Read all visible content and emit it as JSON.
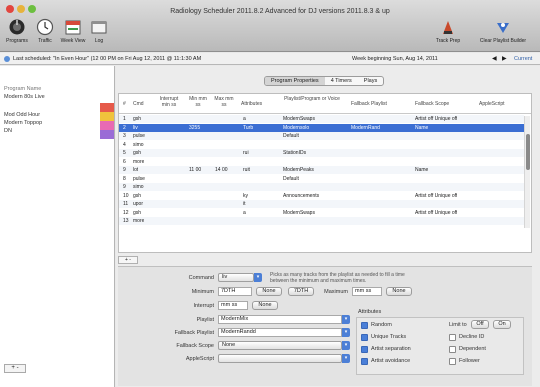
{
  "window": {
    "title": "Radiology Scheduler 2011.8.2 Advanced for DJ versions 2011.8.3 & up"
  },
  "toolbar": {
    "left": [
      {
        "label": "Programs",
        "icon": "radio-dial-icon"
      },
      {
        "label": "Traffic",
        "icon": "clock-icon"
      },
      {
        "label": "Week View",
        "icon": "calendar-icon"
      },
      {
        "label": "Log",
        "icon": "log-window-icon"
      }
    ],
    "right": [
      {
        "label": "Track Prep",
        "icon": "track-prep-icon"
      },
      {
        "label": "Clear Playlist Builder",
        "icon": "playlist-builder-icon"
      }
    ]
  },
  "status": {
    "last_scheduled": "Last scheduled: \"In Even Hour\" (12 00 PM on Fri Aug 12, 2011 @ 11:1:30 AM",
    "week_label": "Week beginning Sun, Aug 14, 2011",
    "prev": "◀",
    "next": "▶",
    "current": "Current"
  },
  "sidebar": {
    "items": [
      {
        "label": "Program Name"
      },
      {
        "label": "Modern 80s Live"
      },
      {
        "label": "Mod Odd Hour"
      },
      {
        "label": "Modern Toppop"
      },
      {
        "label": "DN"
      }
    ],
    "add_label": "+ -"
  },
  "program_tabs": [
    {
      "label": "Program Properties",
      "active": true
    },
    {
      "label": "4 Timers"
    },
    {
      "label": "Plays"
    }
  ],
  "table": {
    "columns": [
      "#",
      "Cmd",
      "Interrupt min ss",
      "Min mm ss",
      "Max mm ss",
      "Attributes",
      "Playlist/Program or Voice",
      "Fallback Playlist",
      "Fallback Scope",
      "AppleScript"
    ],
    "rows": [
      {
        "n": "1",
        "cmd": "gsh",
        "interrupt": "",
        "min": "",
        "max": "",
        "attr": "a",
        "playlist": "ModernSwaps",
        "fallback": "",
        "scope": "Artist off  Unique off",
        "script": ""
      },
      {
        "n": "2",
        "cmd": "liv",
        "interrupt": "",
        "min": "3255",
        "max": "",
        "attr": "Turb",
        "playlist": "Modernsolo",
        "fallback": "ModernRand",
        "scope": "Name",
        "script": ""
      },
      {
        "n": "3",
        "cmd": "pulse",
        "interrupt": "",
        "min": "",
        "max": "",
        "attr": "",
        "playlist": "Default",
        "fallback": "",
        "scope": "",
        "script": ""
      },
      {
        "n": "4",
        "cmd": "simo",
        "interrupt": "",
        "min": "",
        "max": "",
        "attr": "",
        "playlist": "",
        "fallback": "",
        "scope": "",
        "script": ""
      },
      {
        "n": "5",
        "cmd": "gsh",
        "interrupt": "",
        "min": "",
        "max": "",
        "attr": "rui",
        "playlist": "StationIDs",
        "fallback": "",
        "scope": "",
        "script": ""
      },
      {
        "n": "6",
        "cmd": "more",
        "interrupt": "",
        "min": "",
        "max": "",
        "attr": "",
        "playlist": "",
        "fallback": "",
        "scope": "",
        "script": ""
      },
      {
        "n": "9",
        "cmd": "lot",
        "interrupt": "",
        "min": "11 00",
        "max": "14 00",
        "attr": "ruit",
        "playlist": "ModernPeaks",
        "fallback": "",
        "scope": "Name",
        "script": ""
      },
      {
        "n": "8",
        "cmd": "pulse",
        "interrupt": "",
        "min": "",
        "max": "",
        "attr": "",
        "playlist": "Default",
        "fallback": "",
        "scope": "",
        "script": ""
      },
      {
        "n": "9",
        "cmd": "simo",
        "interrupt": "",
        "min": "",
        "max": "",
        "attr": "",
        "playlist": "",
        "fallback": "",
        "scope": "",
        "script": ""
      },
      {
        "n": "10",
        "cmd": "gsh",
        "interrupt": "",
        "min": "",
        "max": "",
        "attr": "ky",
        "playlist": "Announcements",
        "fallback": "",
        "scope": "Artist off  Unique off",
        "script": ""
      },
      {
        "n": "11",
        "cmd": "upor",
        "interrupt": "",
        "min": "",
        "max": "",
        "attr": "it",
        "playlist": "",
        "fallback": "",
        "scope": "",
        "script": ""
      },
      {
        "n": "12",
        "cmd": "gsh",
        "interrupt": "",
        "min": "",
        "max": "",
        "attr": "a",
        "playlist": "ModernSwaps",
        "fallback": "",
        "scope": "Artist off  Unique off",
        "script": ""
      },
      {
        "n": "13",
        "cmd": "more",
        "interrupt": "",
        "min": "",
        "max": "",
        "attr": "",
        "playlist": "",
        "fallback": "",
        "scope": "",
        "script": ""
      }
    ],
    "add_label": "+ -"
  },
  "editor": {
    "command_label": "Command",
    "command_value": "liv",
    "command_note": "Picks as many tracks from the playlist as needed to fill a time between the minimum and maximum times.",
    "minimum_label": "Minimum",
    "minimum_value": "7DTH",
    "minimum_btn": "None",
    "maximum_btn_left": "7DTH",
    "maximum_label": "Maximum",
    "maximum_value": "mm ss",
    "maximum_btn": "None",
    "interrupt_label": "Interrupt",
    "interrupt_value": "mm ss",
    "interrupt_btn": "None",
    "playlist_label": "Playlist",
    "playlist_value": "ModernMix",
    "fallback_playlist_label": "Fallback Playlist",
    "fallback_playlist_value": "ModernRandd",
    "fallback_scope_label": "Fallback Scope",
    "fallback_scope_value": "None",
    "applescript_label": "AppleScript",
    "applescript_value": "",
    "attributes_label": "Attributes",
    "limit_label": "Limit to",
    "limit_value": "Off",
    "limit_btn": "On",
    "attributes": [
      {
        "label": "Random",
        "checked": true
      },
      {
        "label": "Unique Tracks",
        "checked": true
      },
      {
        "label": "Artist separation",
        "checked": true
      },
      {
        "label": "Artist avoidance",
        "checked": true
      },
      {
        "label": "Decline ID",
        "checked": false
      },
      {
        "label": "Dependent",
        "checked": false
      },
      {
        "label": "Follower",
        "checked": false
      }
    ]
  },
  "colors": {
    "selection": "#3b6ed3",
    "accent": "#4a7fd8",
    "close": "#e2463f",
    "minimize": "#e7b33c",
    "maximize": "#6cbf3f"
  }
}
